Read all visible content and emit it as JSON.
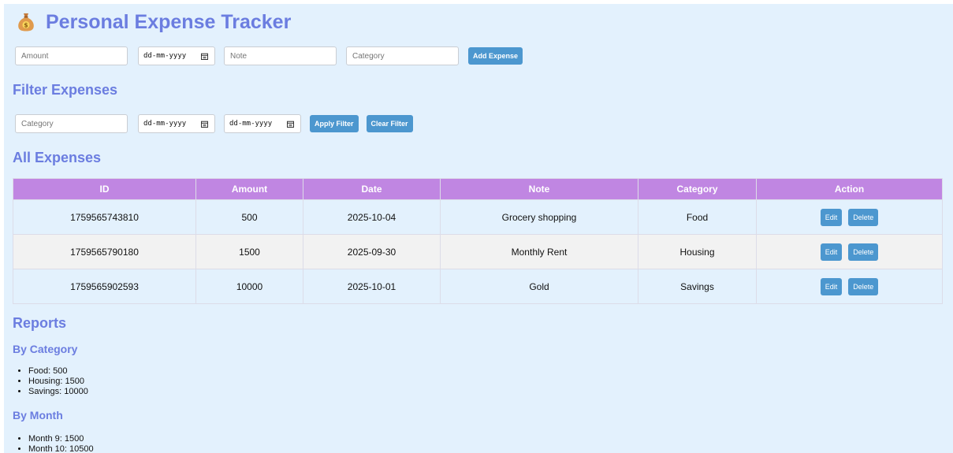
{
  "header": {
    "title": "Personal Expense Tracker",
    "icon": "money-bag-icon"
  },
  "add_form": {
    "amount_placeholder": "Amount",
    "date_placeholder": "dd-mm-yyyy",
    "note_placeholder": "Note",
    "category_placeholder": "Category",
    "add_label": "Add Expense"
  },
  "filter": {
    "title": "Filter Expenses",
    "category_placeholder": "Category",
    "from_date_placeholder": "dd-mm-yyyy",
    "to_date_placeholder": "dd-mm-yyyy",
    "apply_label": "Apply Filter",
    "clear_label": "Clear Filter"
  },
  "expenses": {
    "title": "All Expenses",
    "columns": [
      "ID",
      "Amount",
      "Date",
      "Note",
      "Category",
      "Action"
    ],
    "rows": [
      {
        "id": "1759565743810",
        "amount": "500",
        "date": "2025-10-04",
        "note": "Grocery shopping",
        "category": "Food"
      },
      {
        "id": "1759565790180",
        "amount": "1500",
        "date": "2025-09-30",
        "note": "Monthly Rent",
        "category": "Housing"
      },
      {
        "id": "1759565902593",
        "amount": "10000",
        "date": "2025-10-01",
        "note": "Gold",
        "category": "Savings"
      }
    ],
    "edit_label": "Edit",
    "delete_label": "Delete"
  },
  "reports": {
    "title": "Reports",
    "by_category": {
      "title": "By Category",
      "items": [
        "Food: 500",
        "Housing: 1500",
        "Savings: 10000"
      ]
    },
    "by_month": {
      "title": "By Month",
      "items": [
        "Month 9: 1500",
        "Month 10: 10500"
      ]
    }
  },
  "colors": {
    "background": "#e3f1fd",
    "heading": "#6b7de0",
    "table_header": "#c086e2",
    "button": "#4c97cf",
    "row_alt": "#f2f2f2"
  }
}
